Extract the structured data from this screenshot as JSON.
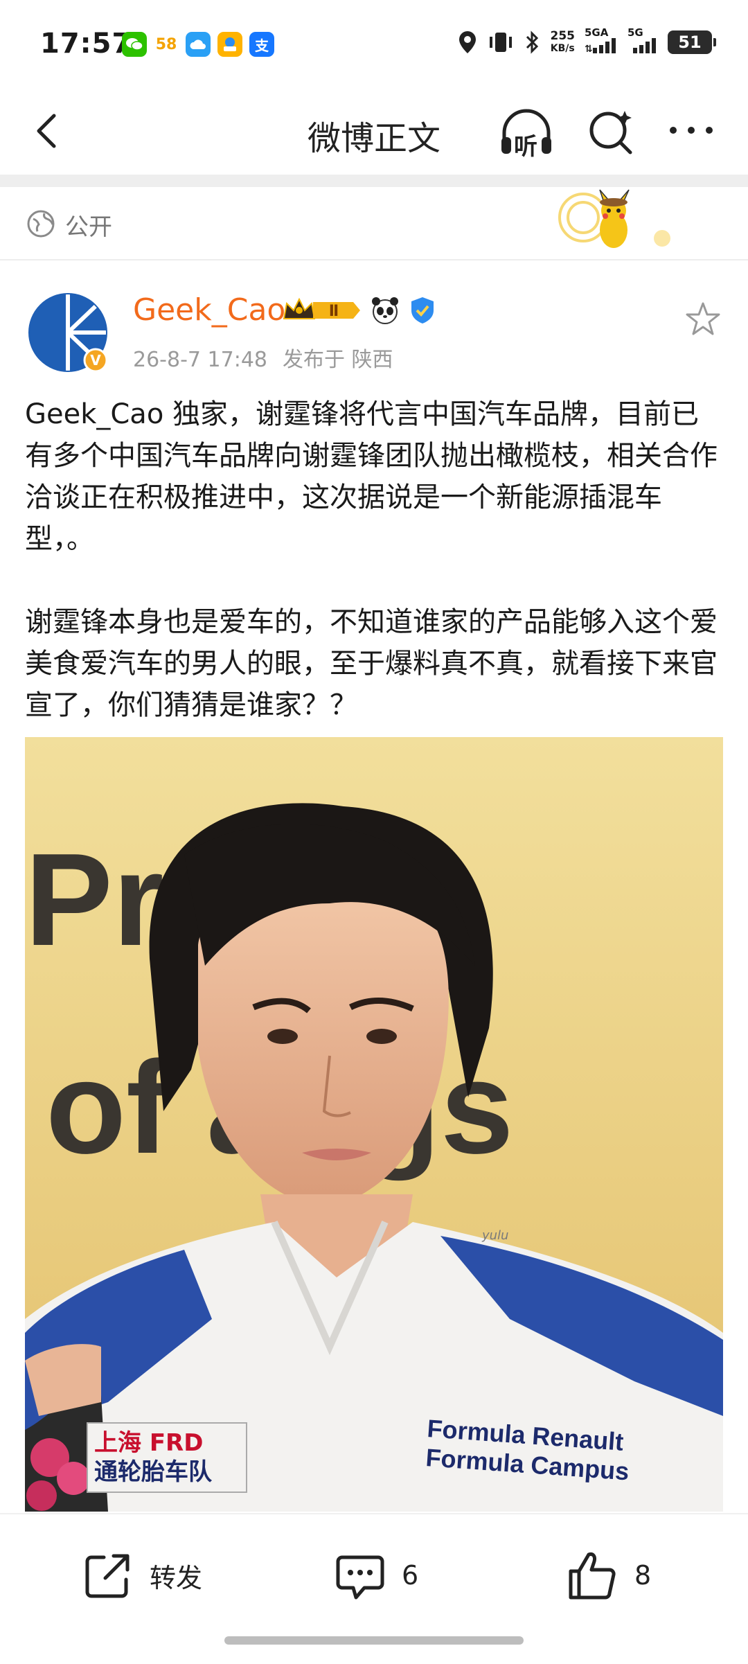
{
  "status_bar": {
    "time": "17:57",
    "speed_value": "255",
    "speed_unit": "KB/s",
    "net1": "5GA",
    "net2": "5G",
    "battery": "51",
    "apps": [
      {
        "name": "wechat-icon",
        "glyph": "",
        "color": "#2dc100"
      },
      {
        "name": "58-app-icon",
        "glyph": "58",
        "color": "#ffffff"
      },
      {
        "name": "cloud-app-icon",
        "glyph": "",
        "color": "#2aa0f5"
      },
      {
        "name": "shop-app-icon",
        "glyph": "",
        "color": "#ffb300"
      },
      {
        "name": "alipay-icon",
        "glyph": "支",
        "color": "#1677ff"
      }
    ]
  },
  "nav": {
    "title": "微博正文",
    "listen_label": "听"
  },
  "visibility": {
    "label": "公开"
  },
  "post": {
    "author": "Geek_Cao",
    "level_badge": "Ⅱ",
    "time": "26-8-7 17:48",
    "location": "发布于 陕西",
    "paragraphs": [
      "Geek_Cao 独家，谢霆锋将代言中国汽车品牌，目前已有多个中国汽车品牌向谢霆锋团队抛出橄榄枝，相关合作洽谈正在积极推进中，这次据说是一个新能源插混车型，。",
      "谢霆锋本身也是爱车的，不知道谁家的产品能够入这个爱美食爱汽车的男人的眼，至于爆料真不真，就看接下来官宣了，你们猜猜是谁家？？"
    ],
    "photo": {
      "backdrop_line1": "Pr    Con",
      "backdrop_line2": "of   angs",
      "jacket_line1": "Formula Renault",
      "jacket_line2": "Formula Campus",
      "sponsor_line1": "上海 FRD",
      "sponsor_line2": "通轮胎车队",
      "watermark": "yulu"
    }
  },
  "actions": {
    "repost_label": "转发",
    "comment_count": "6",
    "like_count": "8"
  }
}
